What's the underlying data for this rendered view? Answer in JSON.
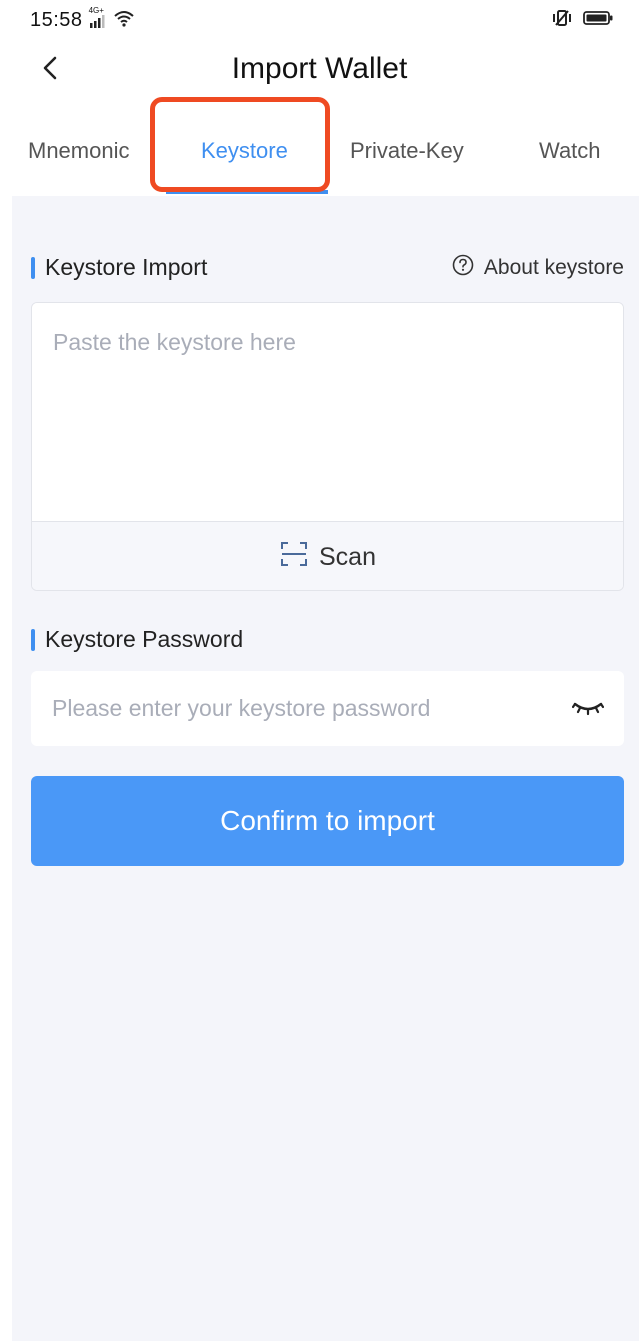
{
  "status_bar": {
    "time": "15:58",
    "network": "4G+"
  },
  "header": {
    "title": "Import Wallet"
  },
  "tabs": [
    {
      "label": "Mnemonic",
      "active": false
    },
    {
      "label": "Keystore",
      "active": true
    },
    {
      "label": "Private-Key",
      "active": false
    },
    {
      "label": "Watch",
      "active": false
    }
  ],
  "keystore_section": {
    "title": "Keystore Import",
    "about_link": "About keystore",
    "textarea_placeholder": "Paste the keystore here",
    "scan_label": "Scan"
  },
  "password_section": {
    "title": "Keystore Password",
    "input_placeholder": "Please enter your keystore password"
  },
  "confirm_button": {
    "label": "Confirm to import"
  },
  "colors": {
    "accent": "#3f8ff0",
    "button": "#4a98f7",
    "highlight": "#ef4a22",
    "background": "#f4f5fa"
  },
  "icons": [
    "back-arrow-icon",
    "question-circle-icon",
    "scan-icon",
    "eye-closed-icon",
    "signal-icon",
    "wifi-icon",
    "vibrate-icon",
    "battery-icon"
  ]
}
